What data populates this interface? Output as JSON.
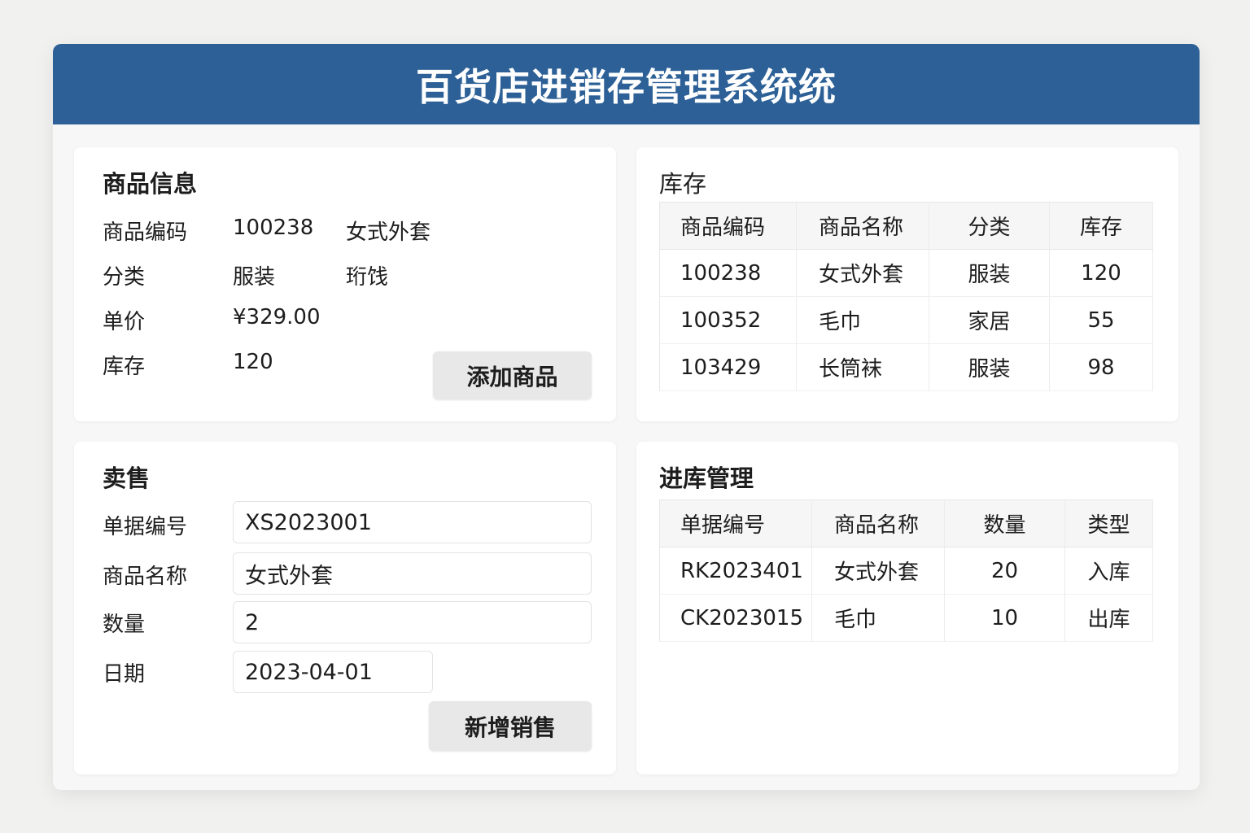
{
  "title": "百货店进销存管理系统统",
  "product_info": {
    "title": "商品信息",
    "rows": [
      {
        "label": "商品编码",
        "value": "100238",
        "extra": "女式外套"
      },
      {
        "label": "分类",
        "value": "服装",
        "extra": "珩饯"
      },
      {
        "label": "单价",
        "value": "¥329.00",
        "extra": ""
      },
      {
        "label": "库存",
        "value": "120",
        "extra": ""
      }
    ],
    "add_button": "添加商品"
  },
  "inventory": {
    "title": "库存",
    "headers": [
      "商品编码",
      "商品名称",
      "分类",
      "库存"
    ],
    "rows": [
      [
        "100238",
        "女式外套",
        "服装",
        "120"
      ],
      [
        "100352",
        "毛巾",
        "家居",
        "55"
      ],
      [
        "103429",
        "长筒袜",
        "服装",
        "98"
      ]
    ]
  },
  "sales": {
    "title": "卖售",
    "fields": [
      {
        "label": "单据编号",
        "value": "XS2023001"
      },
      {
        "label": "商品名称",
        "value": "女式外套"
      },
      {
        "label": "数量",
        "value": "2"
      },
      {
        "label": "日期",
        "value": "2023-04-01"
      }
    ],
    "submit_button": "新增销售"
  },
  "stock_in": {
    "title": "进库管理",
    "headers": [
      "单据编号",
      "商品名称",
      "数量",
      "类型"
    ],
    "rows": [
      [
        "RK2023401",
        "女式外套",
        "20",
        "入库"
      ],
      [
        "CK2023015",
        "毛巾",
        "10",
        "出库"
      ]
    ]
  }
}
